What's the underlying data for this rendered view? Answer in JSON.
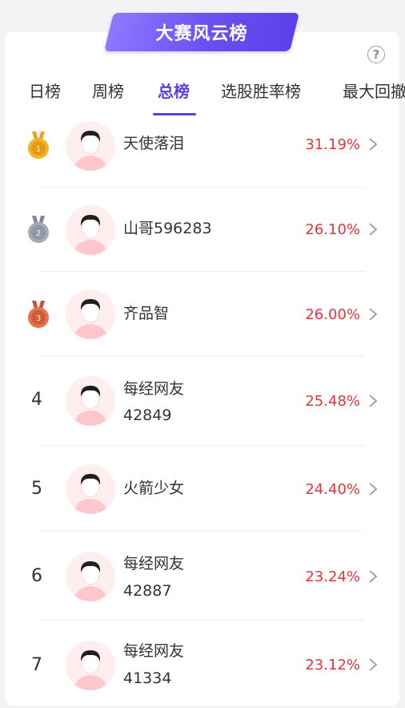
{
  "banner": {
    "title": "大赛风云榜"
  },
  "help": {
    "glyph": "?"
  },
  "tabs": [
    {
      "label": "日榜"
    },
    {
      "label": "周榜"
    },
    {
      "label": "总榜"
    },
    {
      "label": "选股胜率榜"
    },
    {
      "label": "最大回撤"
    }
  ],
  "active_tab": "总榜",
  "rows": [
    {
      "rank": "1",
      "medal": "gold-medal-icon",
      "name": "天使落泪",
      "pct": "31.19%"
    },
    {
      "rank": "2",
      "medal": "silver-medal-icon",
      "name": "山哥596283",
      "pct": "26.10%"
    },
    {
      "rank": "3",
      "medal": "bronze-medal-icon",
      "name": "齐品智",
      "pct": "26.00%"
    },
    {
      "rank": "4",
      "name_line1": "每经网友",
      "name_line2": "42849",
      "pct": "25.48%"
    },
    {
      "rank": "5",
      "name": "火箭少女",
      "pct": "24.40%"
    },
    {
      "rank": "6",
      "name_line1": "每经网友",
      "name_line2": "42887",
      "pct": "23.24%"
    },
    {
      "rank": "7",
      "name_line1": "每经网友",
      "name_line2": "41334",
      "pct": "23.12%"
    }
  ],
  "colors": {
    "accent": "#5a3fe6",
    "positive_pct": "#e0353b",
    "gold": "#f2b52a",
    "silver": "#8f98a6",
    "bronze": "#d9623e"
  }
}
